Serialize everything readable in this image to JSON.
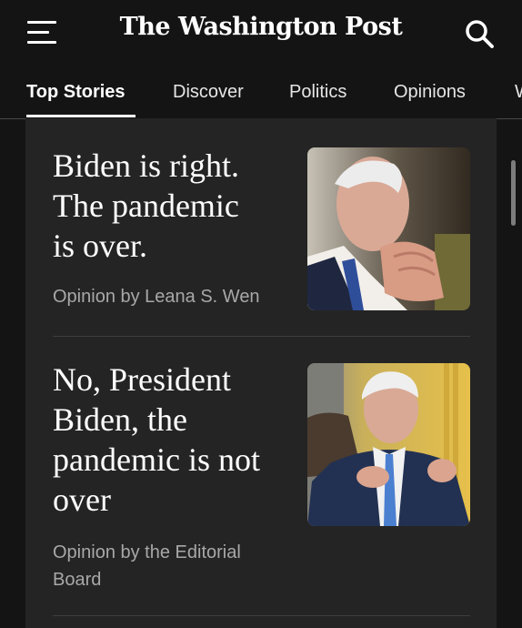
{
  "header": {
    "masthead": "The Washington Post"
  },
  "nav": {
    "tabs": [
      {
        "label": "Top Stories",
        "active": true
      },
      {
        "label": "Discover"
      },
      {
        "label": "Politics"
      },
      {
        "label": "Opinions"
      },
      {
        "label": "W"
      }
    ]
  },
  "stories": [
    {
      "headline_lines": [
        "Biden is right.",
        "The pandemic",
        "is over."
      ],
      "byline": "Opinion by Leana S. Wen",
      "image": "photo-of-joe-biden-hands-clasped"
    },
    {
      "headline_lines": [
        "No, President",
        "Biden, the",
        "pandemic is not",
        "over"
      ],
      "byline_lines": [
        "Opinion by the Editorial",
        "Board"
      ],
      "image": "photo-of-joe-biden-gesturing-in-oval-office"
    }
  ],
  "colors": {
    "background": "#141414",
    "card": "#242424",
    "byline": "#a8a8a8"
  }
}
